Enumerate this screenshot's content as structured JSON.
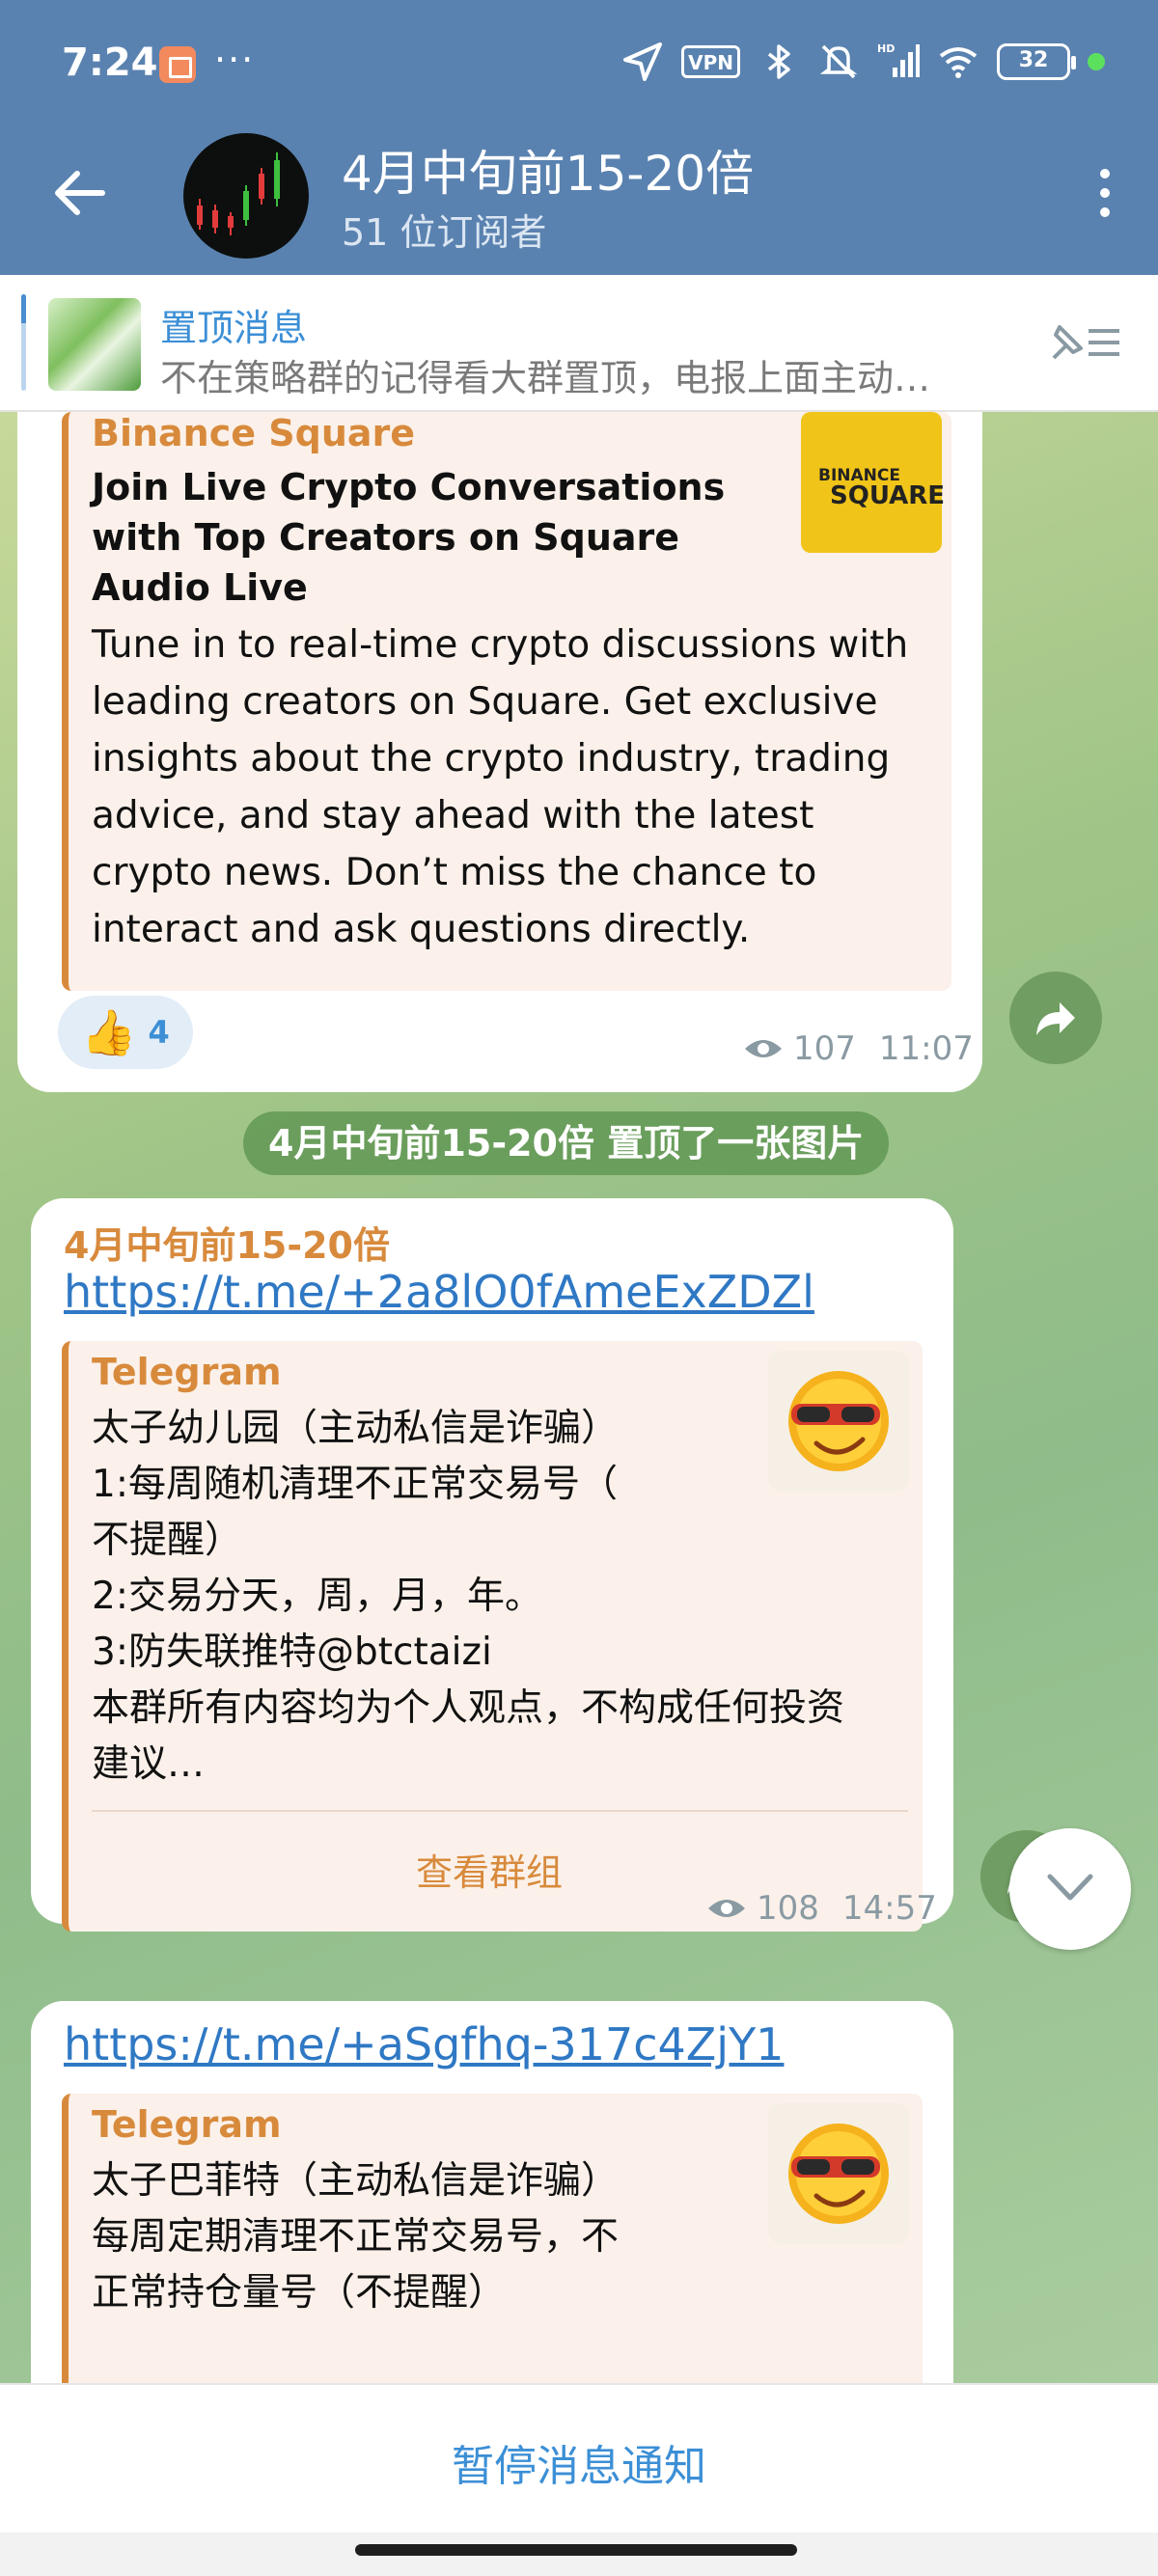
{
  "status_bar": {
    "time": "7:24",
    "more": "···",
    "vpn": "VPN",
    "network": "HD",
    "battery": "32"
  },
  "header": {
    "title": "4月中旬前15-20倍",
    "subtitle": "51 位订阅者"
  },
  "pinned": {
    "title": "置顶消息",
    "text": "不在策略群的记得看大群置顶，电报上面主动…"
  },
  "message1": {
    "preview_site": "Binance Square",
    "preview_title": "Join Live Crypto Conversations with Top Creators on Square Audio Live",
    "preview_desc": "Tune in to real-time crypto discussions with leading creators on Square. Get exclusive insights about the crypto industry, trading advice, and stay ahead with the latest crypto news. Don’t miss the chance to interact and ask questions directly.",
    "logo_text_1": "BINANCE",
    "logo_text_2": "SQUARE",
    "reaction_emoji": "👍",
    "reaction_count": "4",
    "views": "107",
    "time": "11:07"
  },
  "service_message": "4月中旬前15-20倍 置顶了一张图片",
  "message2": {
    "author": "4月中旬前15-20倍",
    "link": "https://t.me/+2a8lO0fAmeExZDZl",
    "preview_site": "Telegram",
    "lines": [
      "太子幼儿园（主动私信是诈骗）",
      "1:每周随机清理不正常交易号（",
      "不提醒）",
      "2:交易分天，周，月，年。",
      "3:防失联推特@btctaizi",
      "本群所有内容均为个人观点，不构成任何投资",
      "建议…"
    ],
    "button": "查看群组",
    "views": "108",
    "time": "14:57"
  },
  "message3": {
    "link": "https://t.me/+aSgfhq-317c4ZjY1",
    "preview_site": "Telegram",
    "lines": [
      "太子巴菲特（主动私信是诈骗）",
      "每周定期清理不正常交易号，不",
      "正常持仓量号（不提醒）"
    ]
  },
  "bottom": {
    "mute_label": "暂停消息通知"
  },
  "colors": {
    "header": "#5a82b0",
    "accent": "#3c8fd6",
    "preview_accent": "#d88a3c"
  }
}
